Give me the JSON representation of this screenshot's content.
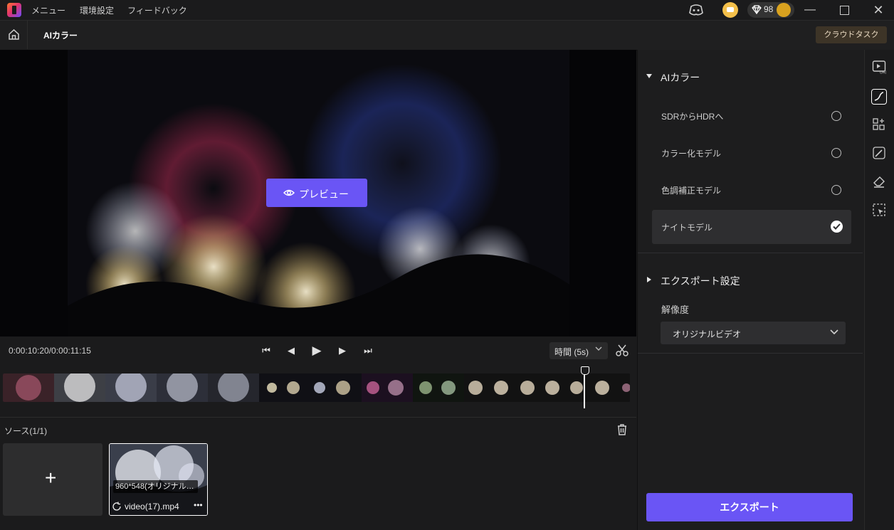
{
  "menubar": {
    "items": [
      "メニュー",
      "環境設定",
      "フィードバック"
    ],
    "gem_count": "98"
  },
  "tab": {
    "title": "AIカラー",
    "cloud_task": "クラウドタスク"
  },
  "preview": {
    "button_label": "プレビュー"
  },
  "transport": {
    "timecode": "0:00:10:20/0:00:11:15",
    "interval": "時間 (5s)"
  },
  "source": {
    "label": "ソース(1/1)",
    "video_resolution": "960*548(オリジナル…",
    "video_name": "video(17).mp4",
    "more": "•••"
  },
  "panel": {
    "ai_color": {
      "title": "AIカラー",
      "options": [
        "SDRからHDRへ",
        "カラー化モデル",
        "色調補正モデル",
        "ナイトモデル"
      ],
      "selected": "ナイトモデル"
    },
    "export_settings": {
      "title": "エクスポート設定",
      "resolution_label": "解像度",
      "resolution_value": "オリジナルビデオ"
    },
    "export_button": "エクスポート"
  },
  "colors": {
    "accent": "#6a55f5",
    "background": "#1b1b1c",
    "panel": "#1d1d1e"
  },
  "icons": [
    "app-logo",
    "home-icon",
    "eye-icon",
    "scissors-icon",
    "trash-icon",
    "plus-icon",
    "uhd-icon",
    "curve-icon",
    "apps-icon",
    "brush-icon",
    "eraser-icon",
    "select-icon",
    "coin-icon",
    "gem-icon",
    "avatar-icon"
  ]
}
